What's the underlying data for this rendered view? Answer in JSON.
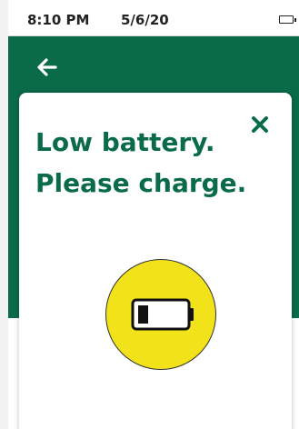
{
  "status_bar": {
    "time": "8:10 PM",
    "date": "5/6/20",
    "battery_icon": "battery-icon"
  },
  "header": {
    "back_icon": "arrow-left-icon",
    "color": "#0a6b49"
  },
  "dialog": {
    "message_line1": "Low battery.",
    "message_line2": "Please charge.",
    "close_icon": "close-icon",
    "illustration_icon": "low-battery-icon",
    "accent_color": "#0a6b49",
    "badge_color": "#f2e21a"
  }
}
